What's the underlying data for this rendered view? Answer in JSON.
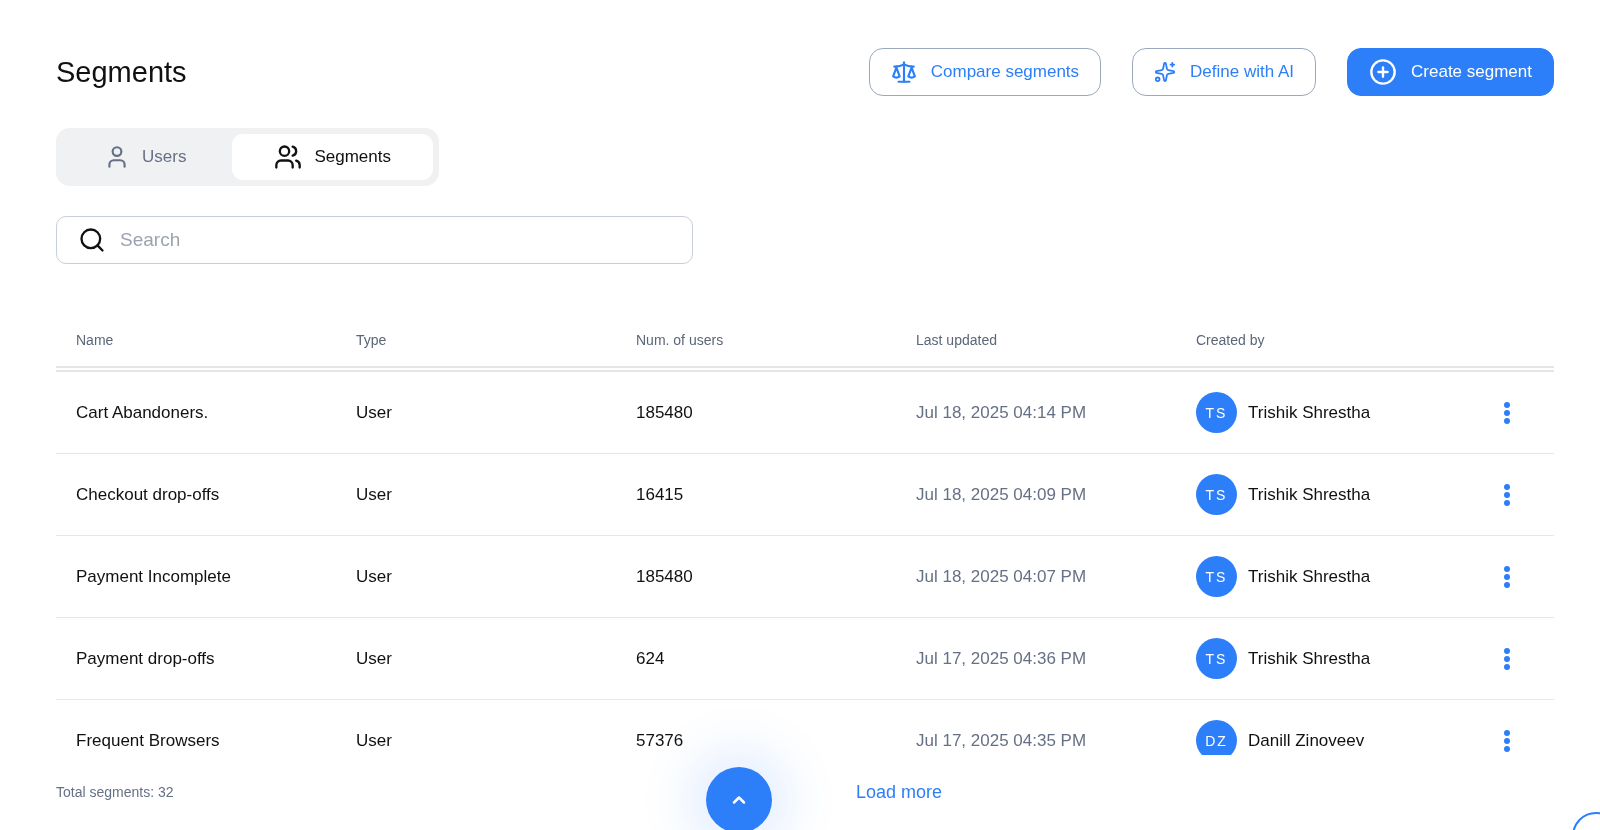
{
  "page": {
    "title": "Segments"
  },
  "actions": [
    {
      "kind": "compare",
      "label": "Compare segments"
    },
    {
      "kind": "ai",
      "label": "Define with AI"
    },
    {
      "kind": "create",
      "label": "Create segment"
    }
  ],
  "tabs": [
    {
      "kind": "user",
      "label": "Users",
      "selected": false
    },
    {
      "kind": "group",
      "label": "Segments",
      "selected": true
    }
  ],
  "search": {
    "placeholder": "Search"
  },
  "table": {
    "columns": [
      "Name",
      "Type",
      "Num. of users",
      "Last updated",
      "Created by"
    ],
    "rows": [
      {
        "name": "Cart Abandoners.",
        "type": "User",
        "users": "185480",
        "updated": "Jul 18, 2025 04:14 PM",
        "initials": "TS",
        "creator": "Trishik Shrestha"
      },
      {
        "name": "Checkout drop-offs",
        "type": "User",
        "users": "16415",
        "updated": "Jul 18, 2025 04:09 PM",
        "initials": "TS",
        "creator": "Trishik Shrestha"
      },
      {
        "name": "Payment Incomplete",
        "type": "User",
        "users": "185480",
        "updated": "Jul 18, 2025 04:07 PM",
        "initials": "TS",
        "creator": "Trishik Shrestha"
      },
      {
        "name": "Payment drop-offs",
        "type": "User",
        "users": "624",
        "updated": "Jul 17, 2025 04:36 PM",
        "initials": "TS",
        "creator": "Trishik Shrestha"
      },
      {
        "name": "Frequent Browsers",
        "type": "User",
        "users": "57376",
        "updated": "Jul 17, 2025 04:35 PM",
        "initials": "DZ",
        "creator": "Danill Zinoveev"
      }
    ]
  },
  "footer": {
    "total": "Total segments: 32",
    "load_more": "Load more"
  }
}
